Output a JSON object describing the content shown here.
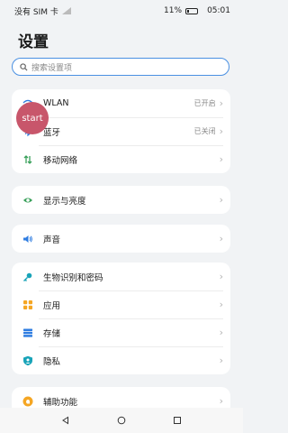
{
  "status": {
    "carrier": "没有 SIM 卡",
    "battery": "11%",
    "time": "05:01"
  },
  "title": "设置",
  "search": {
    "placeholder": "搜索设置项"
  },
  "groups": [
    {
      "items": [
        {
          "label": "WLAN",
          "status": "已开启",
          "icon": "wifi-icon"
        },
        {
          "label": "蓝牙",
          "status": "已关闭",
          "icon": "bluetooth-icon"
        },
        {
          "label": "移动网络",
          "status": "",
          "icon": "mobile-network-icon"
        }
      ]
    },
    {
      "items": [
        {
          "label": "显示与亮度",
          "status": "",
          "icon": "eye-icon"
        }
      ]
    },
    {
      "items": [
        {
          "label": "声音",
          "status": "",
          "icon": "speaker-icon"
        }
      ]
    },
    {
      "items": [
        {
          "label": "生物识别和密码",
          "status": "",
          "icon": "key-icon"
        },
        {
          "label": "应用",
          "status": "",
          "icon": "apps-grid-icon"
        },
        {
          "label": "存储",
          "status": "",
          "icon": "storage-icon"
        },
        {
          "label": "隐私",
          "status": "",
          "icon": "privacy-icon"
        }
      ]
    },
    {
      "items": [
        {
          "label": "辅助功能",
          "status": "",
          "icon": "accessibility-icon"
        }
      ]
    }
  ],
  "overlay": {
    "label": "start"
  },
  "colors": {
    "accent": "#4a90e2",
    "badge": "#c8566b"
  }
}
